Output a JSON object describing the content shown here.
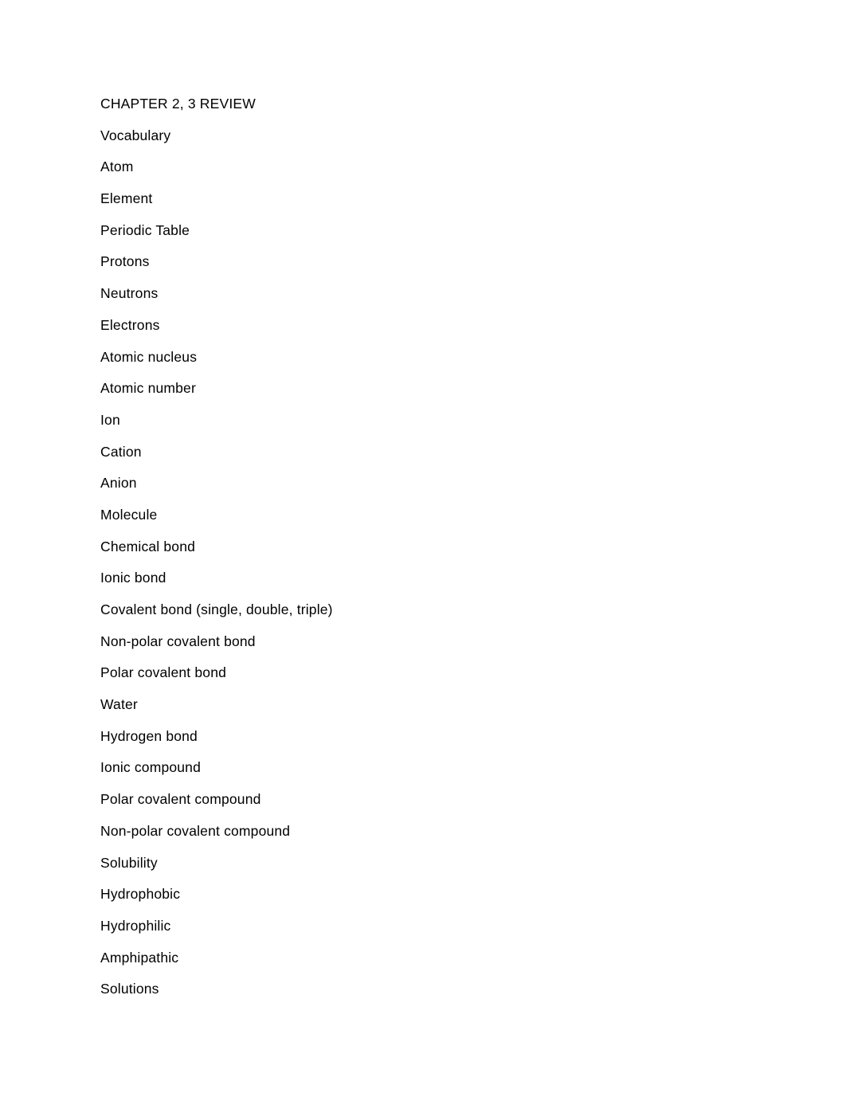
{
  "document": {
    "title": "CHAPTER 2, 3 REVIEW",
    "section_heading": "Vocabulary",
    "vocabulary": [
      "Atom",
      "Element",
      "Periodic Table",
      "Protons",
      "Neutrons",
      "Electrons",
      "Atomic nucleus",
      "Atomic number",
      "Ion",
      "Cation",
      "Anion",
      "Molecule",
      "Chemical bond",
      "Ionic bond",
      "Covalent bond (single, double, triple)",
      "Non-polar covalent bond",
      "Polar covalent bond",
      "Water",
      "Hydrogen bond",
      "Ionic compound",
      "Polar covalent compound",
      "Non-polar covalent compound",
      "Solubility",
      "Hydrophobic",
      "Hydrophilic",
      "Amphipathic",
      "Solutions"
    ]
  },
  "colors": {
    "page_background": "#ffffff",
    "text": "#000000"
  }
}
